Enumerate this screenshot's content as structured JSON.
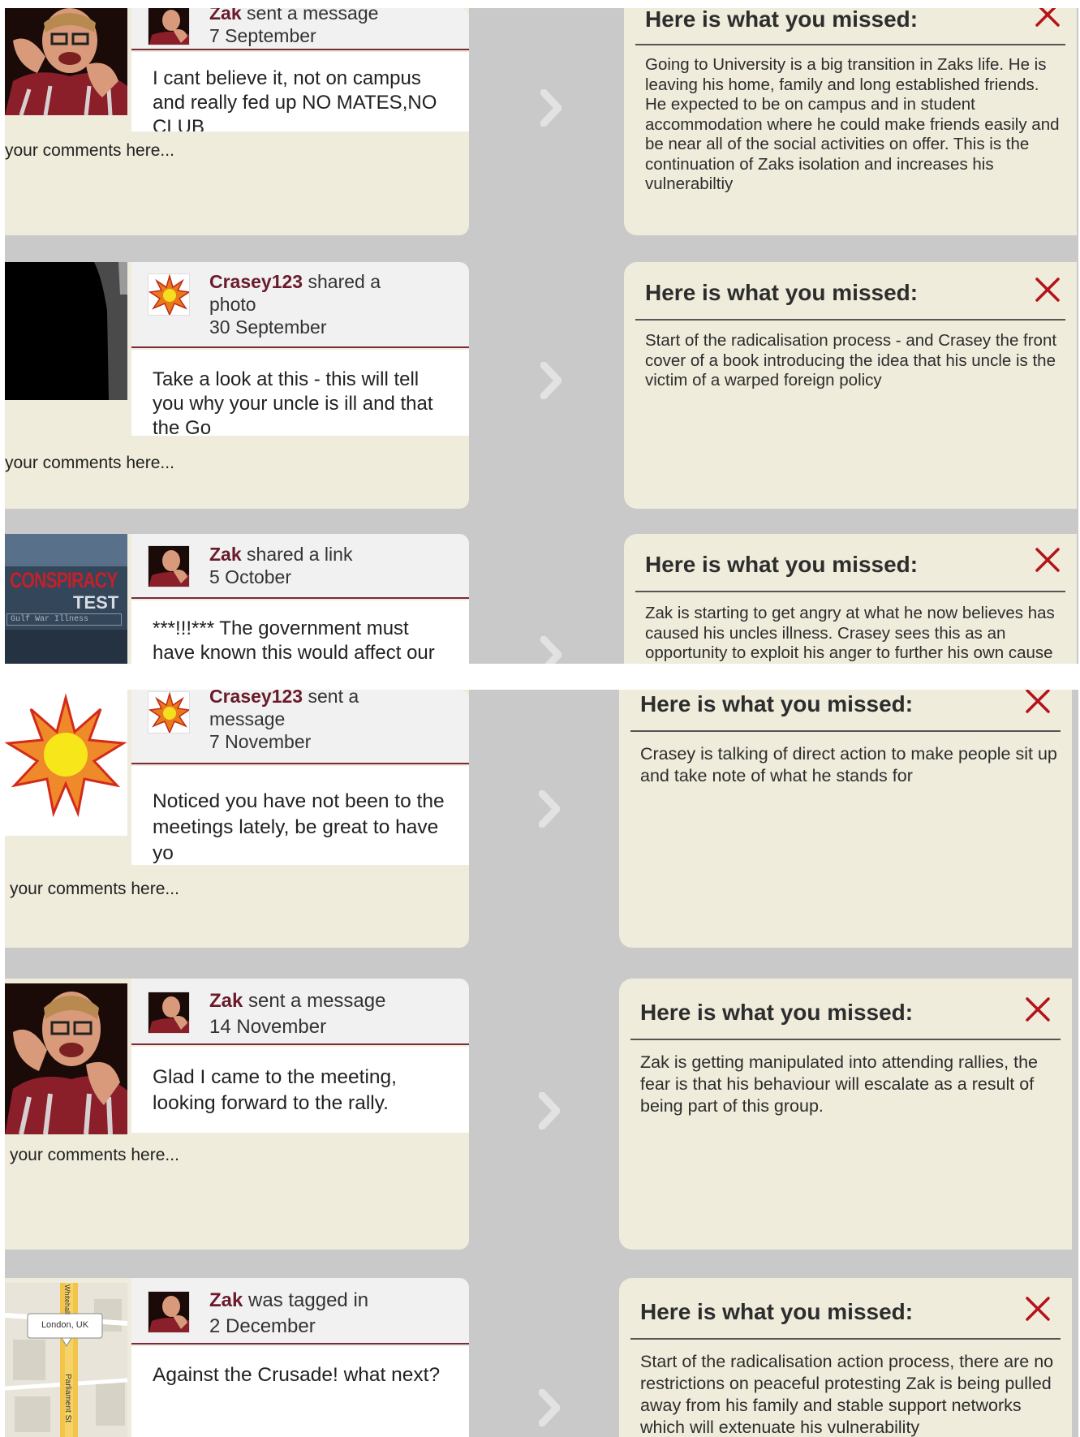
{
  "colors": {
    "panel_bg": "#c9c9c9",
    "card_bg": "#efecdb",
    "author": "#6a1b2b",
    "rule": "#7a2a3a",
    "close_x": "#b5121b"
  },
  "comment_placeholder": "your comments here...",
  "missed_heading": "Here is what you missed:",
  "posts": [
    {
      "author": "Zak",
      "action": " sent a message",
      "date": "7 September",
      "message": "I cant believe it, not on campus and really fed up NO MATES,NO CLUB",
      "image": "zak-photo",
      "avatar": "zak-avatar",
      "missed": "Going to University is a big transition in Zaks life. He is leaving his home, family and long established friends. He expected to be on campus and in student accommodation where he could make friends easily and be near all of the social activities on offer. This is the continuation of Zaks isolation and increases his vulnerabiltiy"
    },
    {
      "author": "Crasey123",
      "action": " shared a photo",
      "date": "30 September",
      "message": "Take a look at this - this will tell you why your uncle is ill and that the Go",
      "image": "silhouette-photo",
      "avatar": "sun-avatar",
      "missed": "Start of the radicalisation process - and Crasey the front cover of a book introducing the idea that his uncle is the victim of a warped foreign policy"
    },
    {
      "author": "Zak",
      "action": " shared a link",
      "date": "5 October",
      "message": "***!!!***  The government must have known this would affect our troops :-",
      "image": "conspiracy-thumbnail",
      "avatar": "zak-avatar",
      "image_text": {
        "line1": "CONSPIRACY",
        "line2": "TEST",
        "line3": "Gulf War Illness"
      },
      "missed": "Zak is starting to get angry at what he now believes has caused his uncles illness. Crasey sees this as an opportunity to exploit his anger to further his own cause"
    },
    {
      "author": "Crasey123",
      "action": " sent a message",
      "date": "7 November",
      "message": "Noticed you have not been to the meetings lately, be great to have yo",
      "image": "sun-image",
      "avatar": "sun-avatar",
      "missed": "Crasey is talking of direct action to make people sit up and take note of what he stands for"
    },
    {
      "author": "Zak",
      "action": " sent a message",
      "date": "14 November",
      "message": "Glad I came to the meeting, looking forward to the rally.",
      "image": "zak-photo",
      "avatar": "zak-avatar",
      "missed": "Zak is getting manipulated into attending rallies, the fear is that his behaviour will escalate as a result of being part of this group."
    },
    {
      "author": "Zak",
      "action": " was tagged in",
      "date": "2 December",
      "message": "Against the Crusade! what next?",
      "image": "map-thumbnail",
      "avatar": "zak-avatar",
      "map_label": "London, UK",
      "map_street_labels": [
        "Whitehall",
        "Parliament St"
      ],
      "missed": "Start of the radicalisation action process, there are no restrictions on peaceful protesting Zak is being pulled away from his family and stable support networks which will extenuate his vulnerability"
    }
  ]
}
